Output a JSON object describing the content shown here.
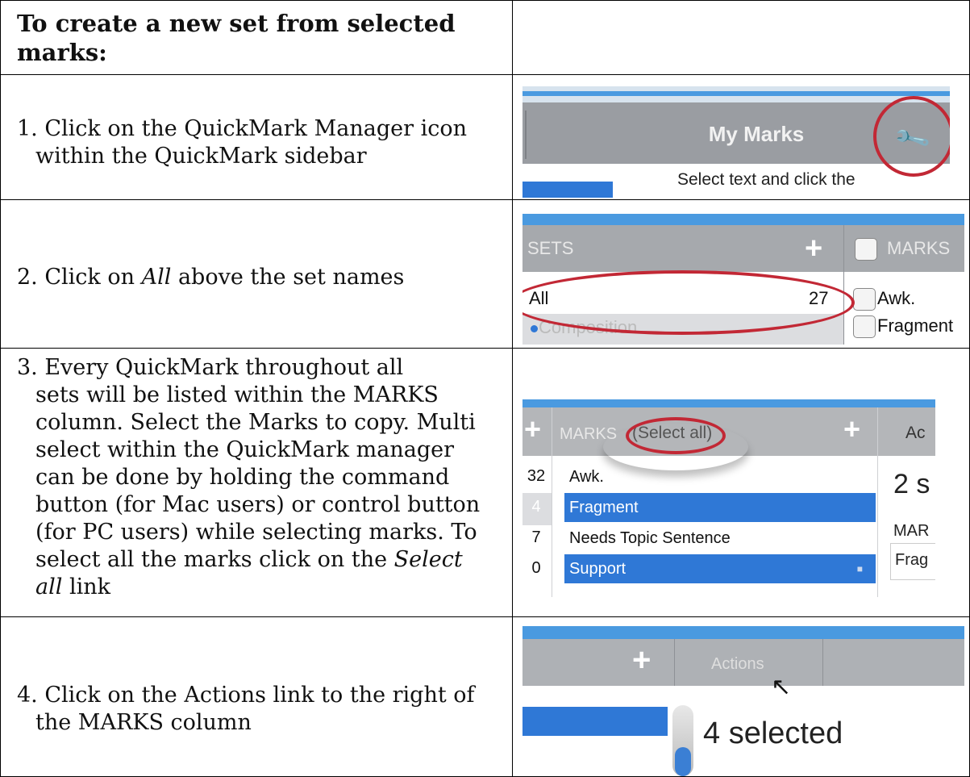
{
  "heading": "To create a new set from selected marks:",
  "steps": {
    "s1_a": "1. Click on the QuickMark Manager icon",
    "s1_b": "within the QuickMark sidebar",
    "s2_a": "2. Click on ",
    "s2_em": "All",
    "s2_b": " above the set names",
    "s3_l1": "3. Every QuickMark throughout all",
    "s3_l2": "sets will be listed within the MARKS",
    "s3_l3": "column. Select the Marks to copy. Multi",
    "s3_l4": "select within the QuickMark manager",
    "s3_l5": "can be done by holding the command",
    "s3_l6": "button (for Mac users) or control button",
    "s3_l7": "(for PC users) while selecting marks. To",
    "s3_l8a": "select all the marks click on the ",
    "s3_l8em": "Select",
    "s3_l9em": "all",
    "s3_l9b": " link",
    "s4_a": "4. Click on the Actions link to the right of",
    "s4_b": "the MARKS column"
  },
  "shot1": {
    "title": "My Marks",
    "icon": "wrench-icon",
    "text": "Select text and click the"
  },
  "shot2": {
    "sets": "SETS",
    "marks": "MARKS",
    "all": "All",
    "count": "27",
    "awk": "Awk.",
    "fragment": "Fragment",
    "composition": "Composition"
  },
  "shot3": {
    "marks": "MARKS",
    "select_all": "(Select all)",
    "actions": "Ac",
    "rows": [
      {
        "num": "32",
        "label": "Awk."
      },
      {
        "num": "4",
        "label": "Fragment"
      },
      {
        "num": "7",
        "label": "Needs Topic Sentence"
      },
      {
        "num": "0",
        "label": "Support"
      }
    ],
    "selected": "2 s",
    "mar": "MAR",
    "frag": "Frag"
  },
  "shot4": {
    "actions": "Actions",
    "selected": "4 selected"
  },
  "colors": {
    "accent_blue": "#2f78d6",
    "highlight_red": "#c22835",
    "header_gray": "#a6a9ad"
  }
}
